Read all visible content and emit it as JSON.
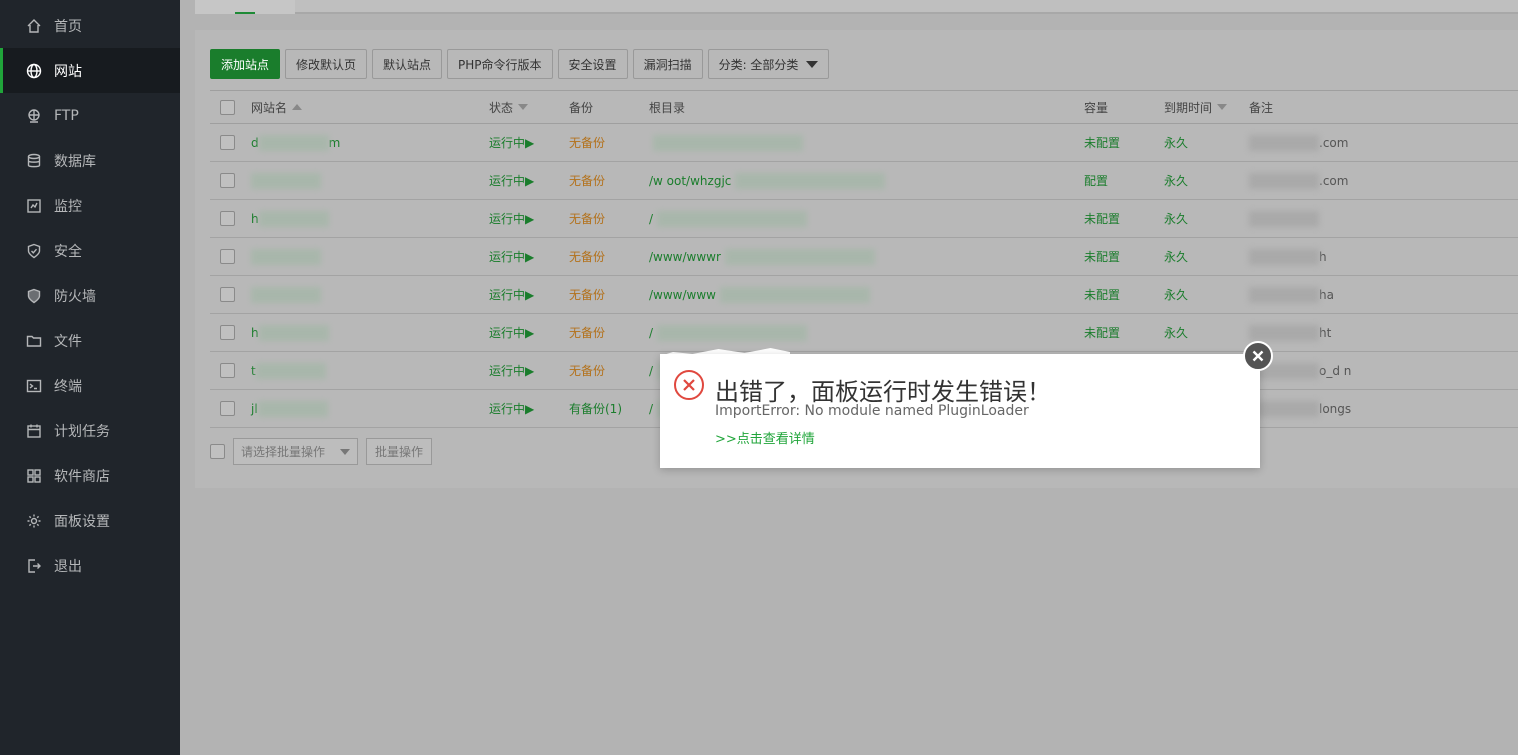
{
  "sidebar": {
    "items": [
      {
        "label": "首页",
        "icon": "home-icon"
      },
      {
        "label": "网站",
        "icon": "globe-icon",
        "active": true
      },
      {
        "label": "FTP",
        "icon": "ftp-icon"
      },
      {
        "label": "数据库",
        "icon": "database-icon"
      },
      {
        "label": "监控",
        "icon": "monitor-icon"
      },
      {
        "label": "安全",
        "icon": "shield-check-icon"
      },
      {
        "label": "防火墙",
        "icon": "firewall-shield-icon"
      },
      {
        "label": "文件",
        "icon": "folder-icon"
      },
      {
        "label": "终端",
        "icon": "terminal-icon"
      },
      {
        "label": "计划任务",
        "icon": "calendar-icon"
      },
      {
        "label": "软件商店",
        "icon": "grid-icon"
      },
      {
        "label": "面板设置",
        "icon": "gear-icon"
      },
      {
        "label": "退出",
        "icon": "logout-icon"
      }
    ]
  },
  "toolbar": {
    "add_site": "添加站点",
    "edit_default_page": "修改默认页",
    "default_site": "默认站点",
    "php_cli_version": "PHP命令行版本",
    "security_settings": "安全设置",
    "vuln_scan": "漏洞扫描",
    "category": "分类: 全部分类"
  },
  "table": {
    "headers": {
      "site_name": "网站名",
      "status": "状态",
      "backup": "备份",
      "root_dir": "根目录",
      "capacity": "容量",
      "expiry": "到期时间",
      "note": "备注"
    },
    "rows": [
      {
        "name": "d",
        "name_tail": "m",
        "status": "运行中▶",
        "backup": "无备份",
        "root": "",
        "capacity": "未配置",
        "expiry": "永久",
        "note": ".com"
      },
      {
        "name": "",
        "name_tail": "",
        "status": "运行中▶",
        "backup": "无备份",
        "root": "/w        oot/whzgjc",
        "capacity": "配置",
        "expiry": "永久",
        "note": ".com"
      },
      {
        "name": "h",
        "name_tail": "",
        "status": "运行中▶",
        "backup": "无备份",
        "root": "/",
        "capacity": "未配置",
        "expiry": "永久",
        "note": ""
      },
      {
        "name": "",
        "name_tail": "",
        "status": "运行中▶",
        "backup": "无备份",
        "root": "/www/wwwr",
        "capacity": "未配置",
        "expiry": "永久",
        "note": "h"
      },
      {
        "name": "",
        "name_tail": "",
        "status": "运行中▶",
        "backup": "无备份",
        "root": "/www/www",
        "capacity": "未配置",
        "expiry": "永久",
        "note": "ha"
      },
      {
        "name": "h",
        "name_tail": "",
        "status": "运行中▶",
        "backup": "无备份",
        "root": "/",
        "capacity": "未配置",
        "expiry": "永久",
        "note": "ht"
      },
      {
        "name": "t",
        "name_tail": "",
        "status": "运行中▶",
        "backup": "无备份",
        "root": "/",
        "capacity": "",
        "expiry": "",
        "note": "o_d       n"
      },
      {
        "name": "jl",
        "name_tail": "",
        "status": "运行中▶",
        "backup": "有备份(1)",
        "root": "/",
        "capacity": "",
        "expiry": "",
        "note": "longs"
      }
    ]
  },
  "batch": {
    "select_placeholder": "请选择批量操作",
    "button": "批量操作"
  },
  "modal": {
    "title": "出错了，面板运行时发生错误！",
    "message": "ImportError: No module named PluginLoader",
    "link": ">>点击查看详情"
  },
  "colors": {
    "accent": "#20a53a",
    "sidebar_bg": "#20252b",
    "error": "#e0483f",
    "warning": "#b3711a"
  }
}
